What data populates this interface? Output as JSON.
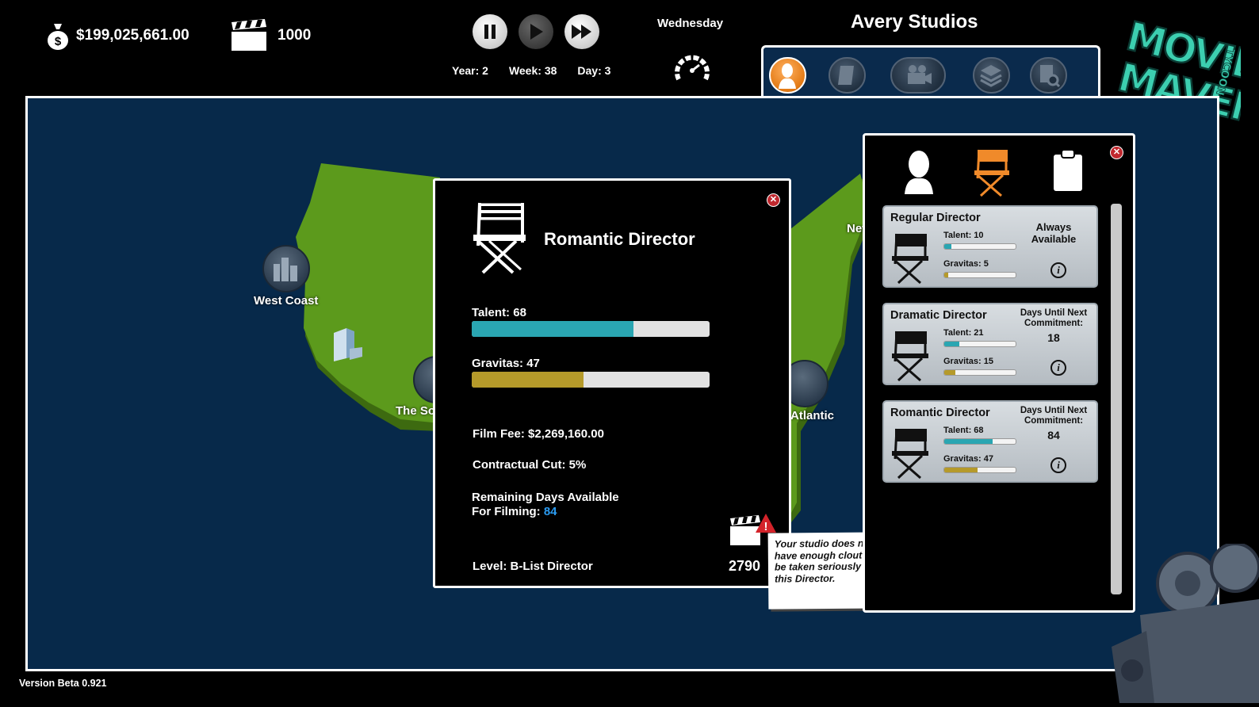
{
  "top": {
    "money": "$199,025,661.00",
    "clout": "1000",
    "day_name": "Wednesday",
    "year_label": "Year:",
    "year": "2",
    "week_label": "Week:",
    "week": "38",
    "day_label": "Day:",
    "day": "3",
    "studio_name": "Avery Studios",
    "logo_text": "MOVIE MAVEN TYCOON"
  },
  "map": {
    "regions": [
      {
        "name": "West Coast"
      },
      {
        "name": "The So"
      },
      {
        "name": "Atlantic"
      },
      {
        "name": "Nev"
      }
    ]
  },
  "detail": {
    "title": "Romantic Director",
    "talent_label": "Talent:",
    "talent": "68",
    "talent_value": 68,
    "gravitas_label": "Gravitas:",
    "gravitas": "47",
    "gravitas_value": 47,
    "film_fee": "Film Fee:  $2,269,160.00",
    "contractual_cut": "Contractual Cut: 5%",
    "remaining_line1": "Remaining Days Available",
    "remaining_line2": "For Filming:",
    "remaining_days": "84",
    "level": "Level: B-List Director",
    "clout_required": "2790"
  },
  "tooltip": {
    "text": "Your studio does not have enough clout to be taken seriously by this Director."
  },
  "panel": {
    "cards": [
      {
        "title": "Regular Director",
        "talent": "Talent: 10",
        "talent_value": 10,
        "gravitas": "Gravitas: 5",
        "gravitas_value": 5,
        "status_line1": "Always",
        "status_line2": "Available",
        "days": ""
      },
      {
        "title": "Dramatic Director",
        "talent": "Talent: 21",
        "talent_value": 21,
        "gravitas": "Gravitas: 15",
        "gravitas_value": 15,
        "status_line1": "Days Until Next",
        "status_line2": "Commitment:",
        "days": "18"
      },
      {
        "title": "Romantic Director",
        "talent": "Talent: 68",
        "talent_value": 68,
        "gravitas": "Gravitas: 47",
        "gravitas_value": 47,
        "status_line1": "Days Until Next",
        "status_line2": "Commitment:",
        "days": "84"
      }
    ]
  },
  "version": "Version Beta 0.921",
  "colors": {
    "talent_bar": "#2aa6b2",
    "gravitas_bar": "#b59a2a",
    "map_ocean": "#07294a",
    "land": "#5c9a1c",
    "active_tab": "#e37a14"
  }
}
